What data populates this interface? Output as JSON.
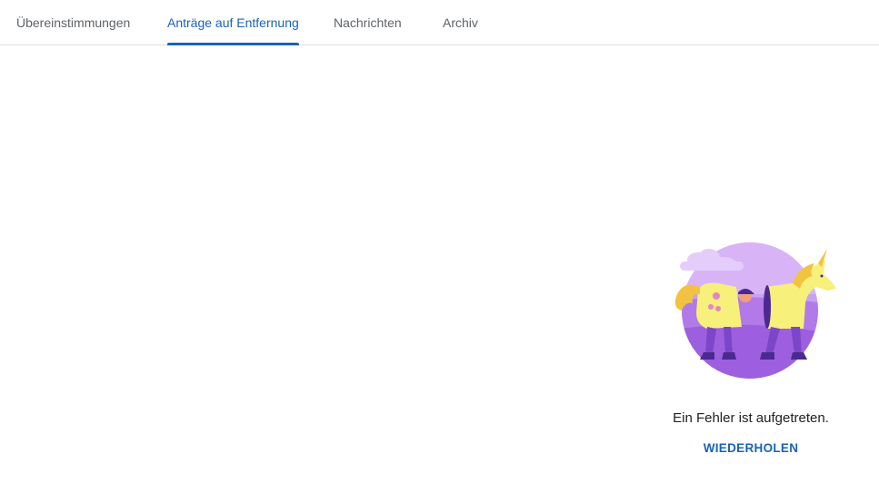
{
  "tabs": [
    {
      "label": "Übereinstimmungen",
      "active": false
    },
    {
      "label": "Anträge auf Entfernung",
      "active": true
    },
    {
      "label": "Nachrichten",
      "active": false
    },
    {
      "label": "Archiv",
      "active": false
    }
  ],
  "error": {
    "message": "Ein Fehler ist aufgetreten.",
    "retry_label": "WIEDERHOLEN",
    "illustration_icon": "unicorn-costume-illustration"
  },
  "colors": {
    "accent": "#1a62b8",
    "illustration_purple": "#c08af0",
    "illustration_yellow": "#f7f07a"
  }
}
